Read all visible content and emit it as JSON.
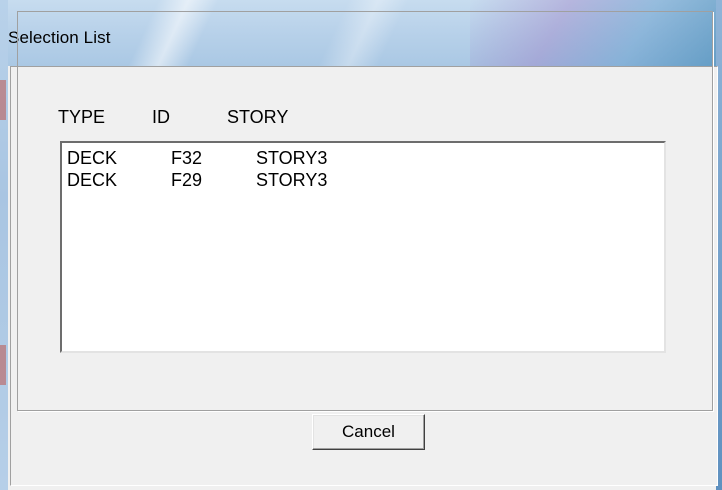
{
  "window": {
    "title": "Selection List"
  },
  "list": {
    "headers": [
      "TYPE",
      "ID",
      "STORY"
    ],
    "rows": [
      [
        "DECK",
        "F32",
        "STORY3"
      ],
      [
        "DECK",
        "F29",
        "STORY3"
      ]
    ]
  },
  "buttons": {
    "cancel_label": "Cancel"
  },
  "colors": {
    "titlebar": "#b9d2ea",
    "dialog_background": "#f0f0f0",
    "list_background": "#ffffff"
  }
}
